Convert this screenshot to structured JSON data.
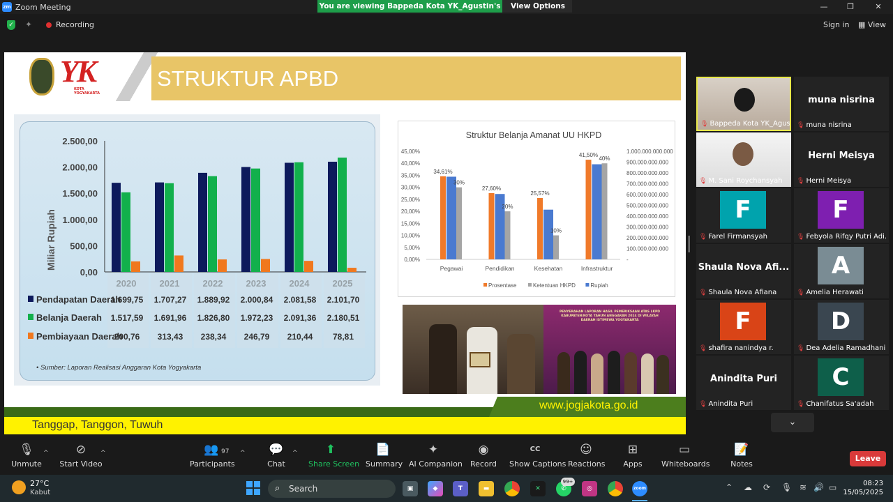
{
  "window": {
    "title": "Zoom Meeting",
    "app_icon": "zm",
    "share_banner": "You are viewing Bappeda Kota YK_Agustin's screen",
    "view_options": "View Options",
    "min_icon": "—",
    "max_icon": "❐",
    "close_icon": "✕"
  },
  "infobar": {
    "recording": "Recording",
    "sign_in": "Sign in",
    "view": "View"
  },
  "slide": {
    "logo_text": "YK",
    "logo_sub": "KOTA\nYOGYAKARTA",
    "title": "STRUKTUR APBD",
    "url": "www.jogjakota.go.id",
    "tagline": "Tanggap, Tanggon, Tuwuh",
    "photo2_caption": "PENYERAHAN LAPORAN HASIL PEMERIKSAAN ATAS LKPD KABUPATEN/KOTA TAHUN ANGGARAN 2024 DI WILAYAH DAERAH ISTIMEWA YOGYAKARTA"
  },
  "chart_data": [
    {
      "type": "bar",
      "ylabel": "Miliar Rupiah",
      "ylim": [
        0,
        2500
      ],
      "yticks": [
        "0,00",
        "500,00",
        "1.000,00",
        "1.500,00",
        "2.000,00",
        "2.500,00"
      ],
      "categories": [
        "2020",
        "2021",
        "2022",
        "2023",
        "2024",
        "2025"
      ],
      "series": [
        {
          "name": "Pendapatan Daerah",
          "color": "#0d1a5c",
          "values": [
            1699.75,
            1707.27,
            1889.92,
            2000.84,
            2081.58,
            2101.7
          ],
          "labels": [
            "1.699,75",
            "1.707,27",
            "1.889,92",
            "2.000,84",
            "2.081,58",
            "2.101,70"
          ]
        },
        {
          "name": "Belanja Daerah",
          "color": "#12b04c",
          "values": [
            1517.59,
            1691.96,
            1826.8,
            1972.23,
            2091.36,
            2180.51
          ],
          "labels": [
            "1.517,59",
            "1.691,96",
            "1.826,80",
            "1.972,23",
            "2.091,36",
            "2.180,51"
          ]
        },
        {
          "name": "Pembiayaan Daerah",
          "color": "#f0781e",
          "values": [
            200.76,
            313.43,
            238.34,
            246.79,
            210.44,
            78.81
          ],
          "labels": [
            "200,76",
            "313,43",
            "238,34",
            "246,79",
            "210,44",
            "78,81"
          ]
        }
      ],
      "source": "Sumber: Laporan Realisasi Anggaran Kota Yogyakarta"
    },
    {
      "type": "bar",
      "title": "Struktur Belanja Amanat UU HKPD",
      "categories": [
        "Pegawai",
        "Pendidikan",
        "Kesehatan",
        "Infrastruktur"
      ],
      "ylim": [
        0,
        45
      ],
      "yticks": [
        "0,00%",
        "5,00%",
        "10,00%",
        "15,00%",
        "20,00%",
        "25,00%",
        "30,00%",
        "35,00%",
        "40,00%",
        "45,00%"
      ],
      "y2lim": [
        0,
        1000000000000
      ],
      "y2ticks": [
        "-",
        "100.000.000.000",
        "200.000.000.000",
        "300.000.000.000",
        "400.000.000.000",
        "500.000.000.000",
        "600.000.000.000",
        "700.000.000.000",
        "800.000.000.000",
        "900.000.000.000",
        "1.000.000.000.000"
      ],
      "series": [
        {
          "name": "Prosentase",
          "color": "#f07a2a",
          "axis": "left",
          "values": [
            34.61,
            27.6,
            25.57,
            41.5
          ],
          "labels": [
            "34,61%",
            "27,60%",
            "25,57%",
            "41,50%"
          ]
        },
        {
          "name": "Ketentuan HKPD",
          "color": "#a5a5a5",
          "axis": "left",
          "values": [
            30,
            20,
            10,
            40
          ],
          "labels": [
            "30%",
            "20%",
            "10%",
            "40%"
          ]
        },
        {
          "name": "Rupiah",
          "color": "#4a7ad0",
          "axis": "right",
          "values": [
            765000000000,
            605000000000,
            460000000000,
            880000000000
          ]
        }
      ],
      "legend": "bottom"
    }
  ],
  "participants": [
    {
      "name": "Bappeda Kota YK_Agustin",
      "type": "video",
      "active": true
    },
    {
      "name": "muna nisrina",
      "big": "muna nisrina",
      "type": "name"
    },
    {
      "name": "M. Sani Roychansyah",
      "type": "video"
    },
    {
      "name": "Herni Meisya",
      "big": "Herni Meisya",
      "type": "name"
    },
    {
      "name": "Farel Firmansyah",
      "letter": "F",
      "color": "#00a3ad",
      "type": "avatar"
    },
    {
      "name": "Febyola Rifqy Putri Adi...",
      "letter": "F",
      "color": "#7e1fb0",
      "type": "avatar"
    },
    {
      "name": "Shaula Nova Afiana",
      "big": "Shaula Nova Afi...",
      "type": "name"
    },
    {
      "name": "Amelia Herawati",
      "letter": "A",
      "color": "#7a8c94",
      "type": "avatar"
    },
    {
      "name": "shafira nanindya r.",
      "letter": "F",
      "color": "#d94417",
      "type": "avatar"
    },
    {
      "name": "Dea Adelia Ramadhani...",
      "letter": "D",
      "color": "#3a4650",
      "type": "avatar"
    },
    {
      "name": "Anindita Puri",
      "big": "Anindita Puri",
      "type": "name"
    },
    {
      "name": "Chanifatus Sa'adah",
      "letter": "C",
      "color": "#0e5f4a",
      "type": "avatar"
    }
  ],
  "toolbar": {
    "unmute": "Unmute",
    "start_video": "Start Video",
    "participants": "Participants",
    "participants_count": "97",
    "chat": "Chat",
    "share_screen": "Share Screen",
    "summary": "Summary",
    "ai_companion": "AI Companion",
    "record": "Record",
    "show_captions": "Show Captions",
    "reactions": "Reactions",
    "apps": "Apps",
    "whiteboards": "Whiteboards",
    "notes": "Notes",
    "leave": "Leave",
    "cc_glyph": "CC"
  },
  "taskbar": {
    "temperature": "27°C",
    "condition": "Kabut",
    "search": "Search",
    "badge": "99+",
    "time": "08:23",
    "date": "15/05/2025",
    "zoom_glyph": "zoom"
  },
  "colors": {
    "share_banner": "#1e9e4a",
    "leave": "#d93a3a",
    "slide_title_band": "#e8c567",
    "footer_yellow": "#fff200",
    "footer_green": "#3a6b17"
  }
}
